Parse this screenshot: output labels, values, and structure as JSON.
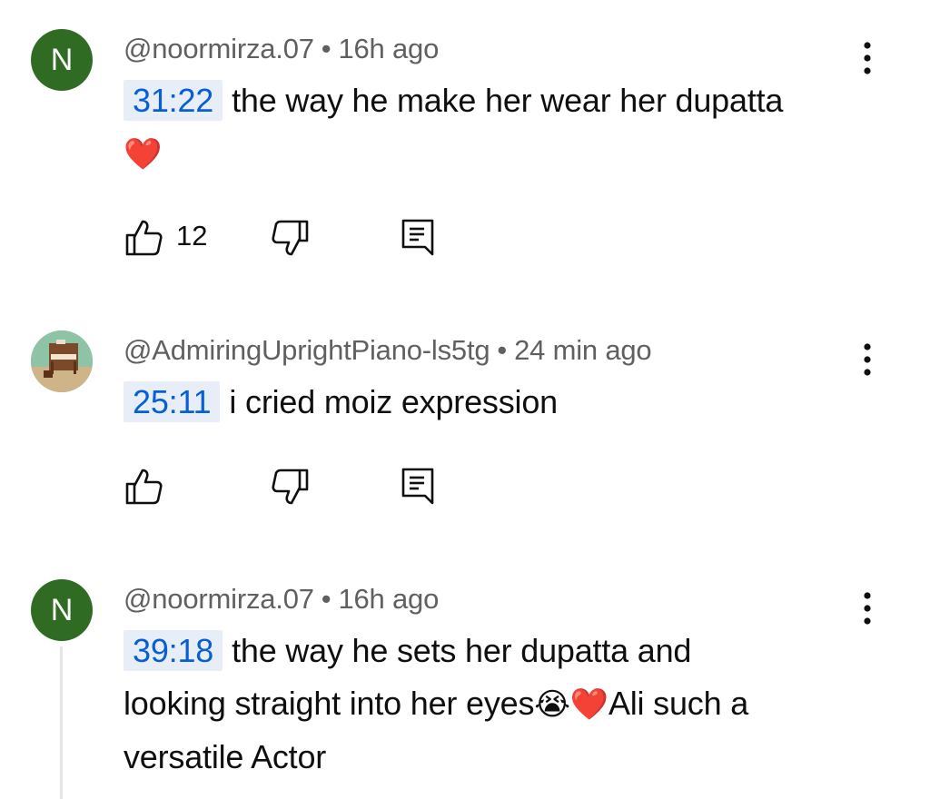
{
  "comments": [
    {
      "avatar_letter": "N",
      "author": "@noormirza.07",
      "separator": "•",
      "time": "16h ago",
      "timestamp": "31:22",
      "text": "the way he make her wear her dupatta",
      "emoji_line": "❤️",
      "like_count": "12"
    },
    {
      "author": "@AdmiringUprightPiano-ls5tg",
      "separator": "•",
      "time": "24 min ago",
      "timestamp": "25:11",
      "text": "i cried moiz expression"
    },
    {
      "avatar_letter": "N",
      "author": "@noormirza.07",
      "separator": "•",
      "time": "16h ago",
      "timestamp": "39:18",
      "text_line1": "the way he sets her dupatta and",
      "text_line2a": "looking straight into her eyes",
      "emoji_cry": "😭",
      "emoji_heart": "❤️",
      "text_line2b": "Ali such a",
      "text_line3": "versatile Actor"
    }
  ],
  "colors": {
    "avatar_green": "#2f6b23",
    "timestamp_bg": "#e8eef8",
    "timestamp_text": "#065fd4",
    "meta_gray": "#606060"
  },
  "icons": [
    "like-icon",
    "dislike-icon",
    "reply-icon",
    "more-vert-icon"
  ]
}
